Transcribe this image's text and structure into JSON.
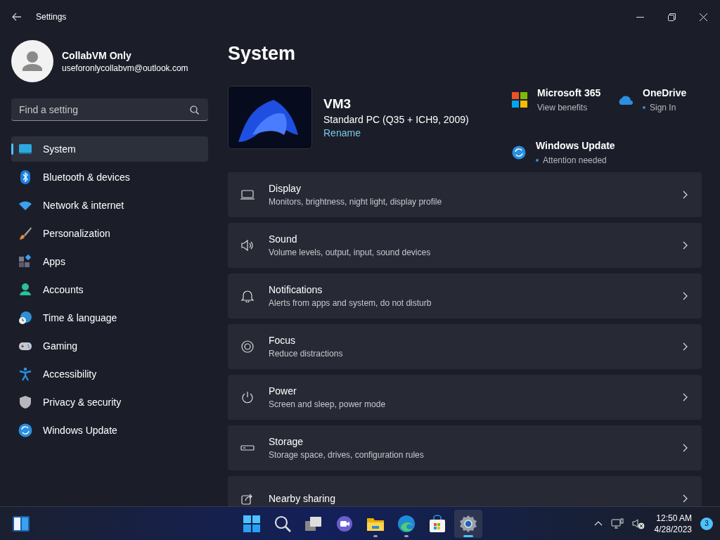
{
  "window": {
    "title": "Settings"
  },
  "account": {
    "name": "CollabVM Only",
    "email": "useforonlycollabvm@outlook.com"
  },
  "search": {
    "placeholder": "Find a setting"
  },
  "nav": [
    {
      "label": "System",
      "selected": true
    },
    {
      "label": "Bluetooth & devices",
      "selected": false
    },
    {
      "label": "Network & internet",
      "selected": false
    },
    {
      "label": "Personalization",
      "selected": false
    },
    {
      "label": "Apps",
      "selected": false
    },
    {
      "label": "Accounts",
      "selected": false
    },
    {
      "label": "Time & language",
      "selected": false
    },
    {
      "label": "Gaming",
      "selected": false
    },
    {
      "label": "Accessibility",
      "selected": false
    },
    {
      "label": "Privacy & security",
      "selected": false
    },
    {
      "label": "Windows Update",
      "selected": false
    }
  ],
  "page_title": "System",
  "device": {
    "name": "VM3",
    "model": "Standard PC (Q35 + ICH9, 2009)",
    "rename": "Rename"
  },
  "quick_links": [
    {
      "title": "Microsoft 365",
      "subtitle": "View benefits",
      "dot": false
    },
    {
      "title": "OneDrive",
      "subtitle": "Sign In",
      "dot": true
    },
    {
      "title": "Windows Update",
      "subtitle": "Attention needed",
      "dot": true
    }
  ],
  "settings": [
    {
      "title": "Display",
      "subtitle": "Monitors, brightness, night light, display profile"
    },
    {
      "title": "Sound",
      "subtitle": "Volume levels, output, input, sound devices"
    },
    {
      "title": "Notifications",
      "subtitle": "Alerts from apps and system, do not disturb"
    },
    {
      "title": "Focus",
      "subtitle": "Reduce distractions"
    },
    {
      "title": "Power",
      "subtitle": "Screen and sleep, power mode"
    },
    {
      "title": "Storage",
      "subtitle": "Storage space, drives, configuration rules"
    },
    {
      "title": "Nearby sharing"
    }
  ],
  "taskbar": {
    "apps": [
      {
        "running": false,
        "selected": false
      },
      {
        "running": false,
        "selected": false
      },
      {
        "running": false,
        "selected": false
      },
      {
        "running": false,
        "selected": false
      },
      {
        "running": true,
        "selected": false
      },
      {
        "running": true,
        "selected": false
      },
      {
        "running": false,
        "selected": false
      },
      {
        "running": true,
        "selected": true
      }
    ],
    "clock": {
      "time": "12:50 AM",
      "date": "4/28/2023"
    },
    "notifications": "3"
  }
}
